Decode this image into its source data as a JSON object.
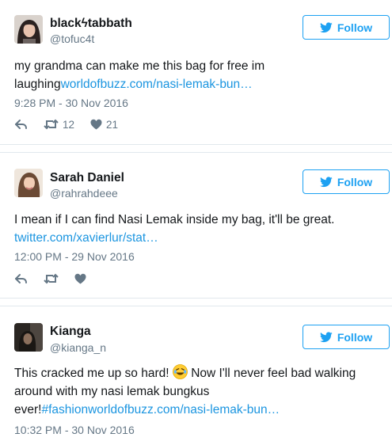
{
  "follow_label": "Follow",
  "tweets": [
    {
      "name": "blackϟtabbath",
      "handle": "@tofuc4t",
      "text": "my grandma can make me this bag for free im laughing",
      "link": "worldofbuzz.com/nasi-lemak-bun…",
      "time": "9:28 PM - 30 Nov 2016",
      "retweets": "12",
      "likes": "21"
    },
    {
      "name": "Sarah Daniel",
      "handle": "@rahrahdeee",
      "text": "I mean if I can find Nasi Lemak inside my bag, it'll be great.",
      "link": "twitter.com/xavierlur/stat…",
      "time": "12:00 PM - 29 Nov 2016"
    },
    {
      "name": "Kianga",
      "handle": "@kianga_n",
      "text_a": "This cracked me up so hard!",
      "text_b": "Now I'll never feel bad walking",
      "text_c": "around with my nasi lemak bungkus",
      "text_d": "ever!",
      "link": "#fashionworldofbuzz.com/nasi-lemak-bun…",
      "time": "10:32 PM - 30 Nov 2016"
    }
  ],
  "icons": [
    "bird-icon",
    "reply-icon",
    "retweet-icon",
    "heart-icon",
    "laughing-emoji-icon"
  ],
  "colors": {
    "accent": "#1da1f2",
    "link": "#1b95e0",
    "muted": "#657786"
  }
}
